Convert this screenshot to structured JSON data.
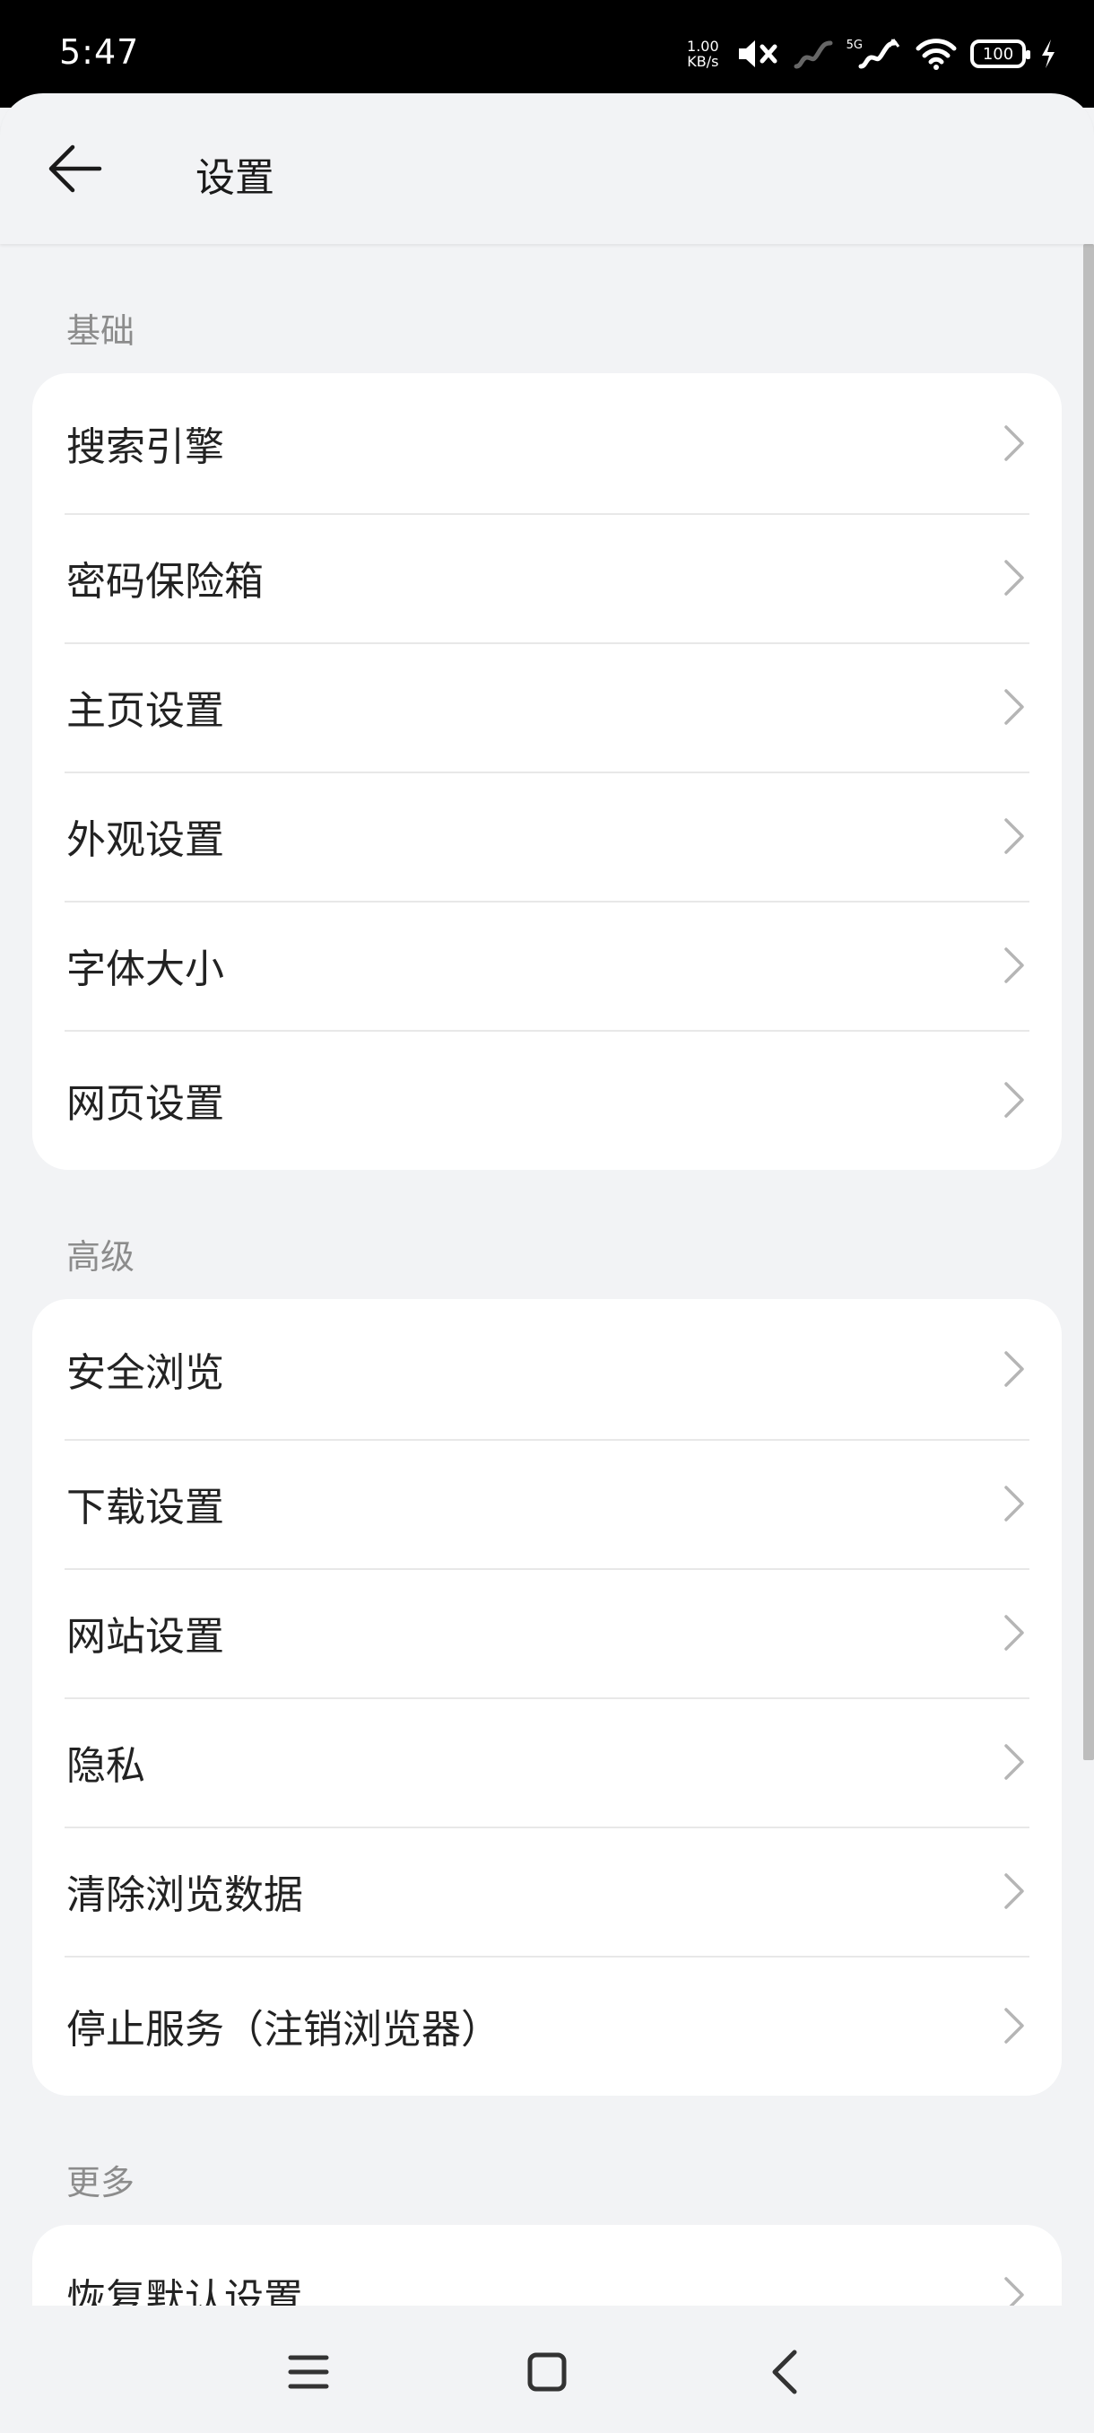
{
  "status_bar": {
    "time": "5:47",
    "net_speed_value": "1.00",
    "net_speed_unit": "KB/s",
    "network_type": "5G",
    "battery_level": "100"
  },
  "header": {
    "title": "设置",
    "back_icon": "arrow-left-icon"
  },
  "sections": [
    {
      "label": "基础",
      "items": [
        {
          "label": "搜索引擎"
        },
        {
          "label": "密码保险箱"
        },
        {
          "label": "主页设置"
        },
        {
          "label": "外观设置"
        },
        {
          "label": "字体大小"
        },
        {
          "label": "网页设置"
        }
      ]
    },
    {
      "label": "高级",
      "items": [
        {
          "label": "安全浏览"
        },
        {
          "label": "下载设置"
        },
        {
          "label": "网站设置"
        },
        {
          "label": "隐私"
        },
        {
          "label": "清除浏览数据"
        },
        {
          "label": "停止服务（注销浏览器）"
        }
      ]
    },
    {
      "label": "更多",
      "items": [
        {
          "label": "恢复默认设置"
        }
      ]
    }
  ],
  "nav_bar": {
    "icons": [
      "menu-icon",
      "home-icon",
      "back-icon"
    ]
  }
}
